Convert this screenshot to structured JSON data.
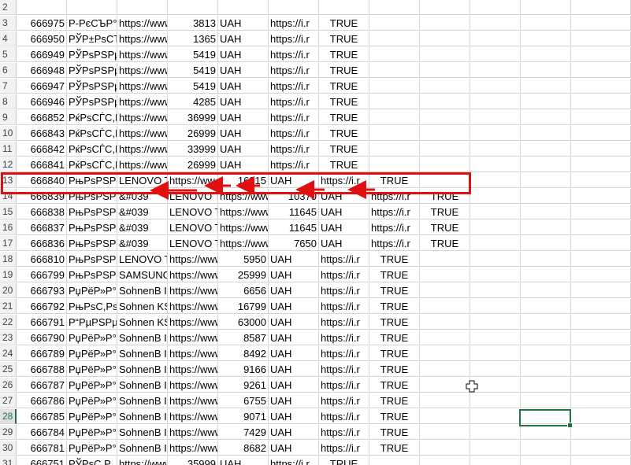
{
  "rows": [
    {
      "n": "2",
      "cells": [
        "",
        "",
        "",
        "",
        "",
        "",
        "",
        "",
        "",
        "",
        "",
        ""
      ]
    },
    {
      "n": "3",
      "cells": [
        "666975",
        "Р-РєСЪР°Р",
        "https://www",
        "3813",
        "UAH",
        "https://i.r",
        "TRUE",
        "",
        "",
        "",
        "",
        ""
      ]
    },
    {
      "n": "4",
      "cells": [
        "666950",
        "РЎР±РѕСЂРѕ",
        "https://www",
        "1365",
        "UAH",
        "https://i.r",
        "TRUE",
        "",
        "",
        "",
        "",
        ""
      ]
    },
    {
      "n": "5",
      "cells": [
        "666949",
        "РЎРѕРЅРµ",
        "https://www",
        "5419",
        "UAH",
        "https://i.r",
        "TRUE",
        "",
        "",
        "",
        "",
        ""
      ]
    },
    {
      "n": "6",
      "cells": [
        "666948",
        "РЎРѕРЅРµ",
        "https://www",
        "5419",
        "UAH",
        "https://i.r",
        "TRUE",
        "",
        "",
        "",
        "",
        ""
      ]
    },
    {
      "n": "7",
      "cells": [
        "666947",
        "РЎРѕРЅРµ",
        "https://www",
        "5419",
        "UAH",
        "https://i.r",
        "TRUE",
        "",
        "",
        "",
        "",
        ""
      ]
    },
    {
      "n": "8",
      "cells": [
        "666946",
        "РЎРѕРЅРµ",
        "https://www",
        "4285",
        "UAH",
        "https://i.r",
        "TRUE",
        "",
        "",
        "",
        "",
        ""
      ]
    },
    {
      "n": "9",
      "cells": [
        "666852",
        "РќРѕСЃС,Р",
        "https://www",
        "36999",
        "UAH",
        "https://i.r",
        "TRUE",
        "",
        "",
        "",
        "",
        ""
      ]
    },
    {
      "n": "10",
      "cells": [
        "666843",
        "РќРѕСЃС,Р",
        "https://www",
        "26999",
        "UAH",
        "https://i.r",
        "TRUE",
        "",
        "",
        "",
        "",
        ""
      ]
    },
    {
      "n": "11",
      "cells": [
        "666842",
        "РќРѕСЃС,Р",
        "https://www",
        "33999",
        "UAH",
        "https://i.r",
        "TRUE",
        "",
        "",
        "",
        "",
        ""
      ]
    },
    {
      "n": "12",
      "cells": [
        "666841",
        "РќРѕСЃС,Р",
        "https://www",
        "26999",
        "UAH",
        "https://i.r",
        "TRUE",
        "",
        "",
        "",
        "",
        ""
      ]
    },
    {
      "n": "13",
      "cells": [
        "666840",
        "РњРѕРЅРё",
        "LENOVO T",
        "https://ww",
        "16915",
        "UAH",
        "https://i.r",
        "TRUE",
        "",
        "",
        "",
        ""
      ]
    },
    {
      "n": "14",
      "cells": [
        "666839",
        "РњРѕРЅРё",
        "&#039",
        "LENOVO T",
        "https://www",
        "10370",
        "UAH",
        "https://i.r",
        "TRUE",
        "",
        "",
        ""
      ]
    },
    {
      "n": "15",
      "cells": [
        "666838",
        "РњРѕРЅРё",
        "&#039",
        "LENOVO T",
        "https://www",
        "11645",
        "UAH",
        "https://i.r",
        "TRUE",
        "",
        "",
        ""
      ]
    },
    {
      "n": "16",
      "cells": [
        "666837",
        "РњРѕРЅРё",
        "&#039",
        "LENOVO T",
        "https://www",
        "11645",
        "UAH",
        "https://i.r",
        "TRUE",
        "",
        "",
        ""
      ]
    },
    {
      "n": "17",
      "cells": [
        "666836",
        "РњРѕРЅРё",
        "&#039",
        "LENOVO T",
        "https://www",
        "7650",
        "UAH",
        "https://i.r",
        "TRUE",
        "",
        "",
        ""
      ]
    },
    {
      "n": "18",
      "cells": [
        "666810",
        "РњРѕРЅРё",
        "LENOVO T",
        "https://www",
        "5950",
        "UAH",
        "https://i.r",
        "TRUE",
        "",
        "",
        "",
        ""
      ]
    },
    {
      "n": "19",
      "cells": [
        "666799",
        "РњРѕРЅРё",
        "SAMSUNG",
        "https://www",
        "25999",
        "UAH",
        "https://i.r",
        "TRUE",
        "",
        "",
        "",
        ""
      ]
    },
    {
      "n": "20",
      "cells": [
        "666793",
        "РџРёР»Р°",
        "SohnenB I",
        "https://www",
        "6656",
        "UAH",
        "https://i.r",
        "TRUE",
        "",
        "",
        "",
        ""
      ]
    },
    {
      "n": "21",
      "cells": [
        "666792",
        "РњРѕС,Рѕ",
        "Sohnen KS",
        "https://www",
        "16799",
        "UAH",
        "https://i.r",
        "TRUE",
        "",
        "",
        "",
        ""
      ]
    },
    {
      "n": "22",
      "cells": [
        "666791",
        "Р“РµРЅРµ",
        "Sohnen KS",
        "https://www",
        "63000",
        "UAH",
        "https://i.r",
        "TRUE",
        "",
        "",
        "",
        ""
      ]
    },
    {
      "n": "23",
      "cells": [
        "666790",
        "РџРёР»Р°",
        "SohnenB I",
        "https://www",
        "8587",
        "UAH",
        "https://i.r",
        "TRUE",
        "",
        "",
        "",
        ""
      ]
    },
    {
      "n": "24",
      "cells": [
        "666789",
        "РџРёР»Р°",
        "SohnenB I",
        "https://www",
        "8492",
        "UAH",
        "https://i.r",
        "TRUE",
        "",
        "",
        "",
        ""
      ]
    },
    {
      "n": "25",
      "cells": [
        "666788",
        "РџРёР»Р°",
        "SohnenB I",
        "https://www",
        "9166",
        "UAH",
        "https://i.r",
        "TRUE",
        "",
        "",
        "",
        ""
      ]
    },
    {
      "n": "26",
      "cells": [
        "666787",
        "РџРёР»Р°",
        "SohnenB I",
        "https://www",
        "9261",
        "UAH",
        "https://i.r",
        "TRUE",
        "",
        "",
        "",
        ""
      ]
    },
    {
      "n": "27",
      "cells": [
        "666786",
        "РџРёР»Р°",
        "SohnenB I",
        "https://www",
        "6755",
        "UAH",
        "https://i.r",
        "TRUE",
        "",
        "",
        "",
        ""
      ]
    },
    {
      "n": "28",
      "cells": [
        "666785",
        "РџРёР»Р°",
        "SohnenB I",
        "https://www",
        "9071",
        "UAH",
        "https://i.r",
        "TRUE",
        "",
        "",
        "",
        ""
      ]
    },
    {
      "n": "29",
      "cells": [
        "666784",
        "РџРёР»Р°",
        "SohnenB I",
        "https://www",
        "7429",
        "UAH",
        "https://i.r",
        "TRUE",
        "",
        "",
        "",
        ""
      ]
    },
    {
      "n": "30",
      "cells": [
        "666781",
        "РџРёР»Р°",
        "SohnenB I",
        "https://www",
        "8682",
        "UAH",
        "https://i.r",
        "TRUE",
        "",
        "",
        "",
        ""
      ]
    },
    {
      "n": "31",
      "cells": [
        "666751",
        "РЎРѕС,Р",
        "https://www",
        "35999",
        "UAH",
        "https://i.r",
        "TRUE",
        "",
        "",
        "",
        "",
        ""
      ]
    }
  ],
  "colors": {
    "highlight": "#e01010",
    "selection": "#217346",
    "grid": "#d4d4d4",
    "header_bg": "#f2f2f2"
  },
  "active_row": "28",
  "icons": {
    "cursor": "plus-cursor-icon",
    "arrow": "left-arrow-icon"
  }
}
